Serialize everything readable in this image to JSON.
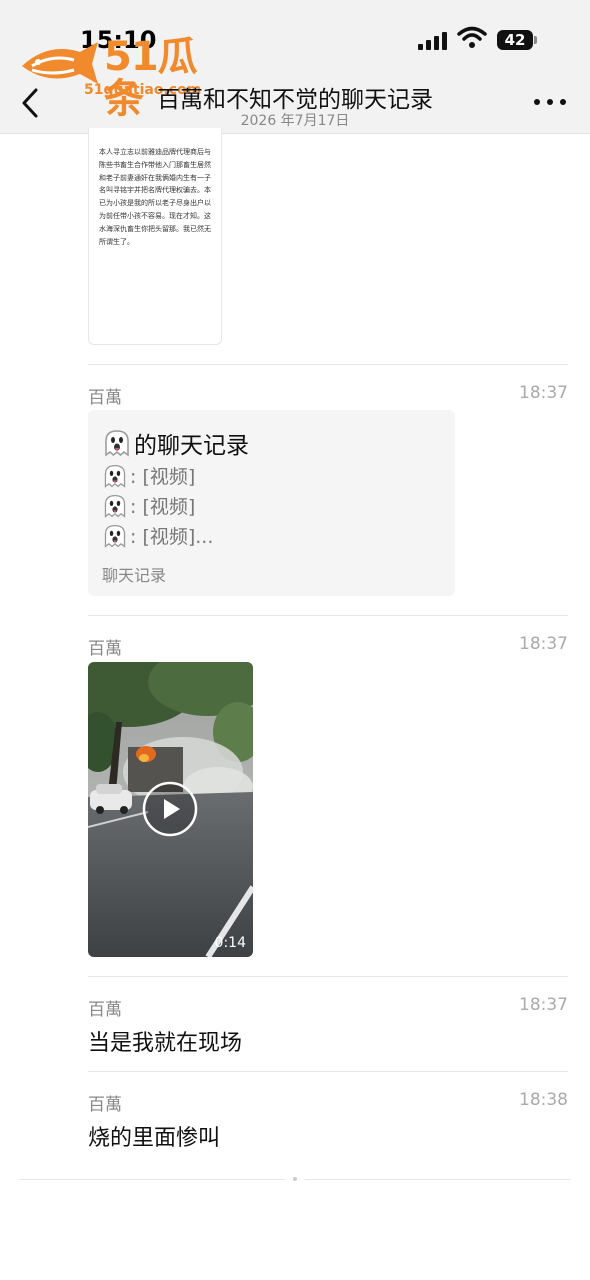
{
  "status": {
    "time": "15:10",
    "battery": "42"
  },
  "watermark": {
    "brand": "51瓜条",
    "url": "51guatiao.com"
  },
  "nav": {
    "title": "百萬和不知不觉的聊天记录",
    "date": "2026 年7月17日"
  },
  "document": {
    "text": "本人寻立志以前雅迪品牌代理商后与陈些书畜生合作带他入门那畜生居然和老子前妻通奸在我俩婚内生有一子名叫寻铭宇并把名牌代理权骗去。本已为小孩是我的所以老子尽身出户以为前任带小孩不容易。现在才知。这水海深仇畜生你把头留那。我已然无所谓生了。"
  },
  "messages": [
    {
      "sender": "百萬",
      "time": "18:37",
      "type": "chat_record",
      "record": {
        "title": "的聊天记录",
        "lines": [
          ": [视频]",
          ": [视频]",
          ": [视频]..."
        ],
        "footer": "聊天记录"
      }
    },
    {
      "sender": "百萬",
      "time": "18:37",
      "type": "video",
      "duration": "0:14"
    },
    {
      "sender": "百萬",
      "time": "18:37",
      "type": "text",
      "text": "当是我就在现场"
    },
    {
      "sender": "百萬",
      "time": "18:38",
      "type": "text",
      "text": "烧的里面惨叫"
    }
  ],
  "icons": {
    "back": "chevron-left-icon",
    "more": "more-dots-icon",
    "signal": "signal-icon",
    "wifi": "wifi-icon",
    "battery": "battery-icon",
    "ghost": "ghost-emoji-icon",
    "play": "play-icon"
  },
  "colors": {
    "watermark": "#f08a2c",
    "nav_bg": "#f2f2f2",
    "record_bg": "#f5f5f5"
  }
}
